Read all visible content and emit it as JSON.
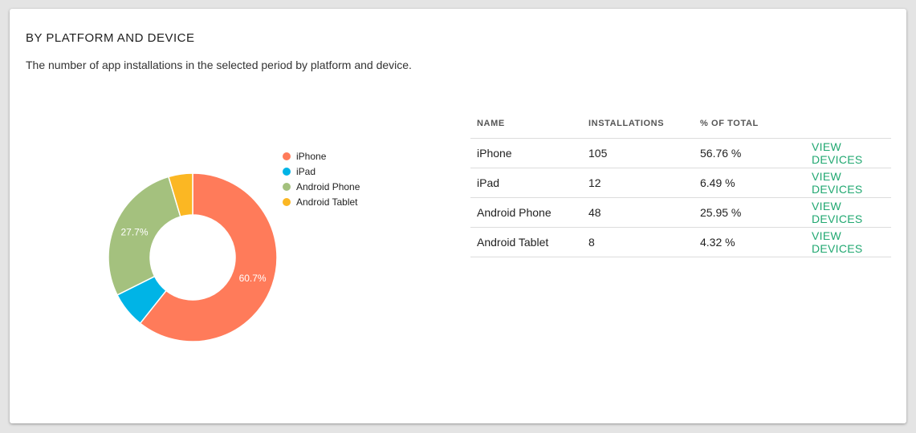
{
  "card": {
    "title": "BY PLATFORM AND DEVICE",
    "description": "The number of app installations in the selected period by platform and device."
  },
  "chart_data": {
    "type": "pie",
    "variant": "donut",
    "categories": [
      "iPhone",
      "iPad",
      "Android Phone",
      "Android Tablet"
    ],
    "values": [
      105,
      12,
      48,
      8
    ],
    "colors": [
      "#ff7b5a",
      "#00b4e6",
      "#a4c17e",
      "#fbb723"
    ],
    "slice_labels": [
      "60.7%",
      "",
      "27.7%",
      ""
    ],
    "legend": {
      "position": "right",
      "entries": [
        "iPhone",
        "iPad",
        "Android Phone",
        "Android Tablet"
      ]
    }
  },
  "table": {
    "headers": [
      "NAME",
      "INSTALLATIONS",
      "% OF TOTAL",
      ""
    ],
    "rows": [
      {
        "name": "iPhone",
        "installations": "105",
        "percent": "56.76 %",
        "action": "VIEW DEVICES"
      },
      {
        "name": "iPad",
        "installations": "12",
        "percent": "6.49 %",
        "action": "VIEW DEVICES"
      },
      {
        "name": "Android Phone",
        "installations": "48",
        "percent": "25.95 %",
        "action": "VIEW DEVICES"
      },
      {
        "name": "Android Tablet",
        "installations": "8",
        "percent": "4.32 %",
        "action": "VIEW DEVICES"
      }
    ]
  },
  "colors": {
    "link": "#21a871",
    "background": "#e4e4e4",
    "card": "#ffffff"
  }
}
